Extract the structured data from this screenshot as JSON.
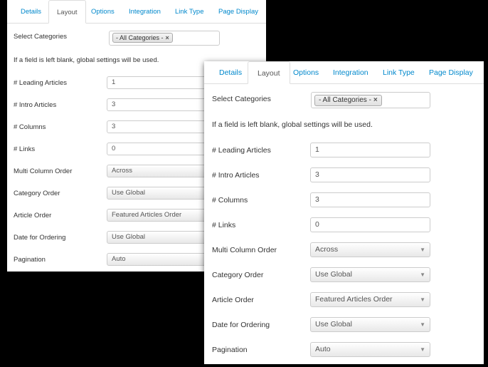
{
  "tabs": [
    "Details",
    "Layout",
    "Options",
    "Integration",
    "Link Type",
    "Page Display"
  ],
  "select_categories": {
    "label": "Select Categories",
    "chip": "- All Categories -",
    "remove_icon": "close-x-icon"
  },
  "note": "If a field is left blank, global settings will be used.",
  "fields": {
    "leading_articles": {
      "label": "# Leading Articles",
      "value": "1"
    },
    "intro_articles": {
      "label": "# Intro Articles",
      "value": "3"
    },
    "columns": {
      "label": "# Columns",
      "value": "3"
    },
    "links": {
      "label": "# Links",
      "value": "0"
    },
    "multi_column_order": {
      "label": "Multi Column Order",
      "value": "Across"
    },
    "category_order": {
      "label": "Category Order",
      "value": "Use Global"
    },
    "article_order": {
      "label": "Article Order",
      "value": "Featured Articles Order"
    },
    "date_for_ordering": {
      "label": "Date for Ordering",
      "value": "Use Global"
    },
    "pagination": {
      "label": "Pagination",
      "value": "Auto"
    }
  },
  "icons": {
    "dropdown": "chevron-down-icon",
    "remove": "close-x-icon"
  },
  "colors": {
    "link": "#0088cc",
    "background": "#000000",
    "panel": "#ffffff"
  }
}
